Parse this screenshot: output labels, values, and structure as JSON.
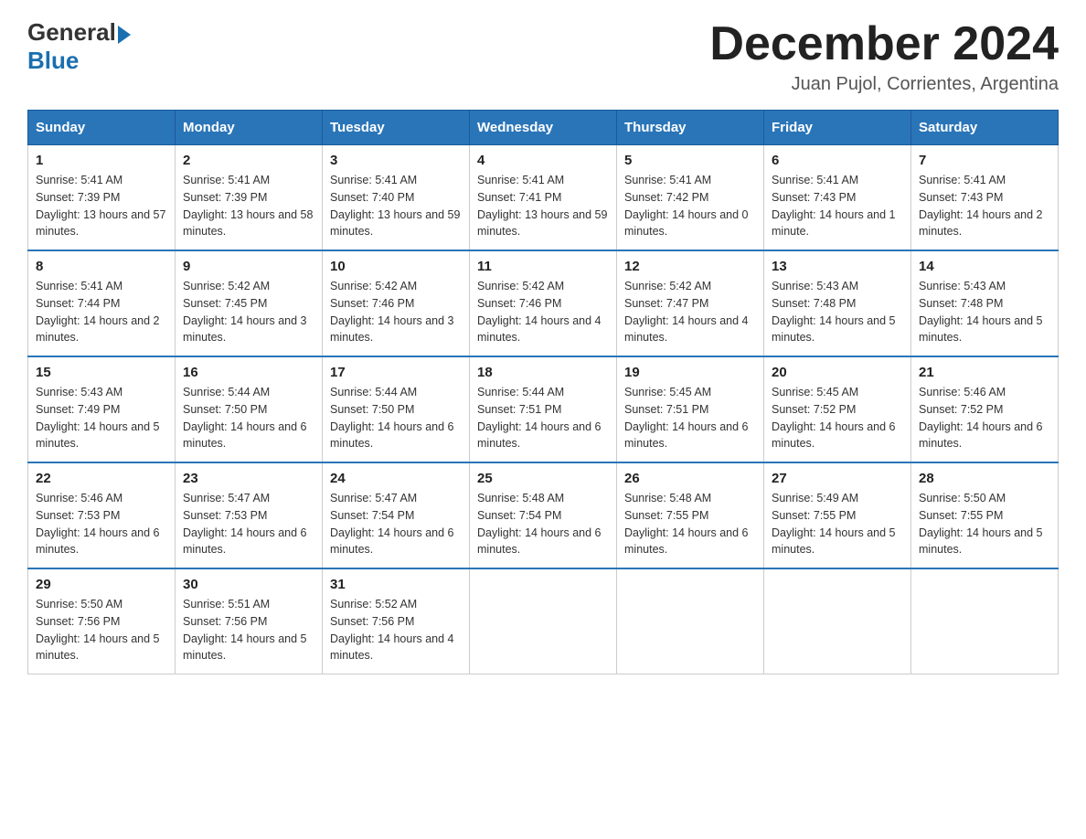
{
  "logo": {
    "general": "General",
    "blue": "Blue"
  },
  "title": {
    "month": "December 2024",
    "location": "Juan Pujol, Corrientes, Argentina"
  },
  "days_of_week": [
    "Sunday",
    "Monday",
    "Tuesday",
    "Wednesday",
    "Thursday",
    "Friday",
    "Saturday"
  ],
  "weeks": [
    [
      {
        "day": "1",
        "sunrise": "5:41 AM",
        "sunset": "7:39 PM",
        "daylight": "13 hours and 57 minutes."
      },
      {
        "day": "2",
        "sunrise": "5:41 AM",
        "sunset": "7:39 PM",
        "daylight": "13 hours and 58 minutes."
      },
      {
        "day": "3",
        "sunrise": "5:41 AM",
        "sunset": "7:40 PM",
        "daylight": "13 hours and 59 minutes."
      },
      {
        "day": "4",
        "sunrise": "5:41 AM",
        "sunset": "7:41 PM",
        "daylight": "13 hours and 59 minutes."
      },
      {
        "day": "5",
        "sunrise": "5:41 AM",
        "sunset": "7:42 PM",
        "daylight": "14 hours and 0 minutes."
      },
      {
        "day": "6",
        "sunrise": "5:41 AM",
        "sunset": "7:43 PM",
        "daylight": "14 hours and 1 minute."
      },
      {
        "day": "7",
        "sunrise": "5:41 AM",
        "sunset": "7:43 PM",
        "daylight": "14 hours and 2 minutes."
      }
    ],
    [
      {
        "day": "8",
        "sunrise": "5:41 AM",
        "sunset": "7:44 PM",
        "daylight": "14 hours and 2 minutes."
      },
      {
        "day": "9",
        "sunrise": "5:42 AM",
        "sunset": "7:45 PM",
        "daylight": "14 hours and 3 minutes."
      },
      {
        "day": "10",
        "sunrise": "5:42 AM",
        "sunset": "7:46 PM",
        "daylight": "14 hours and 3 minutes."
      },
      {
        "day": "11",
        "sunrise": "5:42 AM",
        "sunset": "7:46 PM",
        "daylight": "14 hours and 4 minutes."
      },
      {
        "day": "12",
        "sunrise": "5:42 AM",
        "sunset": "7:47 PM",
        "daylight": "14 hours and 4 minutes."
      },
      {
        "day": "13",
        "sunrise": "5:43 AM",
        "sunset": "7:48 PM",
        "daylight": "14 hours and 5 minutes."
      },
      {
        "day": "14",
        "sunrise": "5:43 AM",
        "sunset": "7:48 PM",
        "daylight": "14 hours and 5 minutes."
      }
    ],
    [
      {
        "day": "15",
        "sunrise": "5:43 AM",
        "sunset": "7:49 PM",
        "daylight": "14 hours and 5 minutes."
      },
      {
        "day": "16",
        "sunrise": "5:44 AM",
        "sunset": "7:50 PM",
        "daylight": "14 hours and 6 minutes."
      },
      {
        "day": "17",
        "sunrise": "5:44 AM",
        "sunset": "7:50 PM",
        "daylight": "14 hours and 6 minutes."
      },
      {
        "day": "18",
        "sunrise": "5:44 AM",
        "sunset": "7:51 PM",
        "daylight": "14 hours and 6 minutes."
      },
      {
        "day": "19",
        "sunrise": "5:45 AM",
        "sunset": "7:51 PM",
        "daylight": "14 hours and 6 minutes."
      },
      {
        "day": "20",
        "sunrise": "5:45 AM",
        "sunset": "7:52 PM",
        "daylight": "14 hours and 6 minutes."
      },
      {
        "day": "21",
        "sunrise": "5:46 AM",
        "sunset": "7:52 PM",
        "daylight": "14 hours and 6 minutes."
      }
    ],
    [
      {
        "day": "22",
        "sunrise": "5:46 AM",
        "sunset": "7:53 PM",
        "daylight": "14 hours and 6 minutes."
      },
      {
        "day": "23",
        "sunrise": "5:47 AM",
        "sunset": "7:53 PM",
        "daylight": "14 hours and 6 minutes."
      },
      {
        "day": "24",
        "sunrise": "5:47 AM",
        "sunset": "7:54 PM",
        "daylight": "14 hours and 6 minutes."
      },
      {
        "day": "25",
        "sunrise": "5:48 AM",
        "sunset": "7:54 PM",
        "daylight": "14 hours and 6 minutes."
      },
      {
        "day": "26",
        "sunrise": "5:48 AM",
        "sunset": "7:55 PM",
        "daylight": "14 hours and 6 minutes."
      },
      {
        "day": "27",
        "sunrise": "5:49 AM",
        "sunset": "7:55 PM",
        "daylight": "14 hours and 5 minutes."
      },
      {
        "day": "28",
        "sunrise": "5:50 AM",
        "sunset": "7:55 PM",
        "daylight": "14 hours and 5 minutes."
      }
    ],
    [
      {
        "day": "29",
        "sunrise": "5:50 AM",
        "sunset": "7:56 PM",
        "daylight": "14 hours and 5 minutes."
      },
      {
        "day": "30",
        "sunrise": "5:51 AM",
        "sunset": "7:56 PM",
        "daylight": "14 hours and 5 minutes."
      },
      {
        "day": "31",
        "sunrise": "5:52 AM",
        "sunset": "7:56 PM",
        "daylight": "14 hours and 4 minutes."
      },
      null,
      null,
      null,
      null
    ]
  ],
  "labels": {
    "sunrise": "Sunrise:",
    "sunset": "Sunset:",
    "daylight": "Daylight:"
  }
}
